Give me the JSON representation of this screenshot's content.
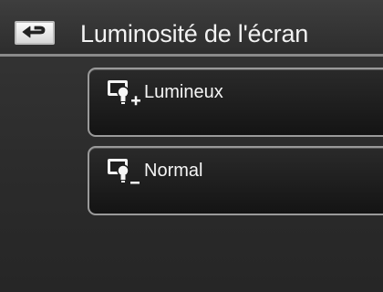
{
  "header": {
    "title": "Luminosité de l'écran",
    "back_icon": "back-arrow-icon"
  },
  "menu": {
    "items": [
      {
        "label": "Lumineux",
        "icon": "screen-brightness-plus-icon",
        "sign": "+"
      },
      {
        "label": "Normal",
        "icon": "screen-brightness-minus-icon",
        "sign": "_"
      }
    ]
  },
  "colors": {
    "background": "#2e2e2e",
    "item_border": "#9a9a9a",
    "text": "#f2f2f2"
  }
}
